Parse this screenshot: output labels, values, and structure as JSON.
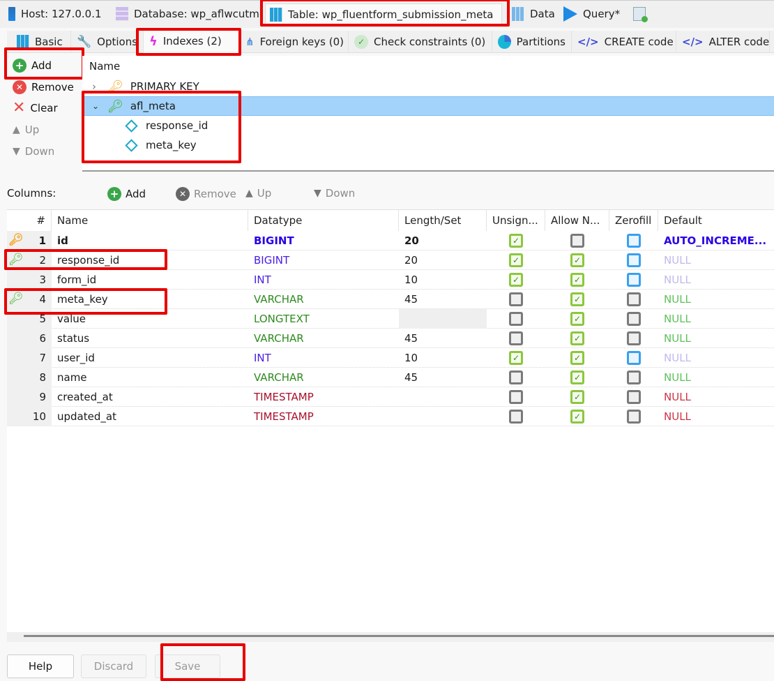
{
  "top_tabs": [
    {
      "label": "Host: 127.0.0.1",
      "icon": "server-icon"
    },
    {
      "label": "Database: wp_aflwcutm",
      "icon": "database-icon"
    },
    {
      "label": "Table: wp_fluentform_submission_meta",
      "icon": "table-icon",
      "active": true
    },
    {
      "label": "Data",
      "icon": "grid-icon"
    },
    {
      "label": "Query*",
      "icon": "play-icon"
    },
    {
      "label": "",
      "icon": "new-query-icon"
    }
  ],
  "sub_tabs": [
    {
      "label": "Basic",
      "icon": "table-icon"
    },
    {
      "label": "Options",
      "icon": "wrench-icon"
    },
    {
      "label": "Indexes (2)",
      "icon": "lightning-icon",
      "active": true
    },
    {
      "label": "Foreign keys (0)",
      "icon": "foreign-key-icon"
    },
    {
      "label": "Check constraints (0)",
      "icon": "check-icon"
    },
    {
      "label": "Partitions",
      "icon": "pie-icon"
    },
    {
      "label": "CREATE code",
      "icon": "code-icon"
    },
    {
      "label": "ALTER code",
      "icon": "code-icon"
    }
  ],
  "index_toolbar": {
    "add": "Add",
    "remove": "Remove",
    "clear": "Clear",
    "up": "Up",
    "down": "Down"
  },
  "index_tree": {
    "header": "Name",
    "items": [
      {
        "name": "PRIMARY KEY",
        "expanded": false,
        "key_color": "#f5a623"
      },
      {
        "name": "afl_meta",
        "expanded": true,
        "selected": true,
        "key_color": "#3db021",
        "children": [
          "response_id",
          "meta_key"
        ]
      }
    ]
  },
  "columns_toolbar": {
    "label": "Columns:",
    "add": "Add",
    "remove": "Remove",
    "up": "Up",
    "down": "Down"
  },
  "columns_grid": {
    "headers": [
      "#",
      "Name",
      "Datatype",
      "Length/Set",
      "Unsign...",
      "Allow N...",
      "Zerofill",
      "Default"
    ],
    "rows": [
      {
        "num": "1",
        "name": "id",
        "key": "primary",
        "datatype": "BIGINT",
        "dtcolor": "#2a00e6",
        "length": "20",
        "unsigned": "on",
        "allow_null": "off",
        "zerofill": "blue",
        "default": "AUTO_INCREME...",
        "defcolor": "#2a00e6",
        "bold": true
      },
      {
        "num": "2",
        "name": "response_id",
        "key": "index",
        "datatype": "BIGINT",
        "dtcolor": "#4a1fe6",
        "length": "20",
        "unsigned": "on",
        "allow_null": "on",
        "zerofill": "blue",
        "default": "NULL",
        "defcolor": "#c3b8ec"
      },
      {
        "num": "3",
        "name": "form_id",
        "key": "",
        "datatype": "INT",
        "dtcolor": "#4a1fe6",
        "length": "10",
        "unsigned": "on",
        "allow_null": "on",
        "zerofill": "blue",
        "default": "NULL",
        "defcolor": "#c3b8ec"
      },
      {
        "num": "4",
        "name": "meta_key",
        "key": "index",
        "datatype": "VARCHAR",
        "dtcolor": "#2e8b1f",
        "length": "45",
        "unsigned": "off",
        "allow_null": "on",
        "zerofill": "off",
        "default": "NULL",
        "defcolor": "#5cc25a"
      },
      {
        "num": "5",
        "name": "value",
        "key": "",
        "datatype": "LONGTEXT",
        "dtcolor": "#2e8b1f",
        "length": "",
        "length_disabled": true,
        "unsigned": "off",
        "allow_null": "on",
        "zerofill": "off",
        "default": "NULL",
        "defcolor": "#5cc25a"
      },
      {
        "num": "6",
        "name": "status",
        "key": "",
        "datatype": "VARCHAR",
        "dtcolor": "#2e8b1f",
        "length": "45",
        "unsigned": "off",
        "allow_null": "on",
        "zerofill": "off",
        "default": "NULL",
        "defcolor": "#5cc25a"
      },
      {
        "num": "7",
        "name": "user_id",
        "key": "",
        "datatype": "INT",
        "dtcolor": "#4a1fe6",
        "length": "10",
        "unsigned": "on",
        "allow_null": "on",
        "zerofill": "blue",
        "default": "NULL",
        "defcolor": "#c3b8ec"
      },
      {
        "num": "8",
        "name": "name",
        "key": "",
        "datatype": "VARCHAR",
        "dtcolor": "#2e8b1f",
        "length": "45",
        "unsigned": "off",
        "allow_null": "on",
        "zerofill": "off",
        "default": "NULL",
        "defcolor": "#5cc25a"
      },
      {
        "num": "9",
        "name": "created_at",
        "key": "",
        "datatype": "TIMESTAMP",
        "dtcolor": "#a8102a",
        "length": "",
        "unsigned": "off",
        "allow_null": "on",
        "zerofill": "off",
        "default": "NULL",
        "defcolor": "#cc3344"
      },
      {
        "num": "10",
        "name": "updated_at",
        "key": "",
        "datatype": "TIMESTAMP",
        "dtcolor": "#a8102a",
        "length": "",
        "unsigned": "off",
        "allow_null": "on",
        "zerofill": "off",
        "default": "NULL",
        "defcolor": "#cc3344"
      }
    ]
  },
  "footer": {
    "help": "Help",
    "discard": "Discard",
    "save": "Save"
  },
  "colors": {
    "highlight": "#e80000",
    "selection": "#a3d3fb",
    "primary_key": "#f5a623",
    "index_key": "#3db021"
  }
}
